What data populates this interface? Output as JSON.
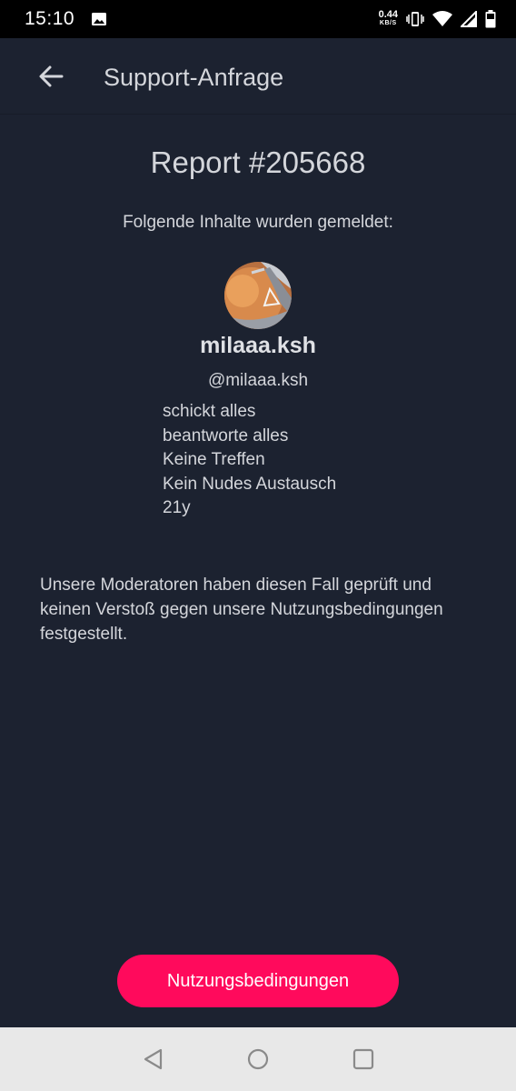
{
  "status_bar": {
    "time": "15:10",
    "net_speed_value": "0.44",
    "net_speed_unit": "KB/S",
    "icons": [
      "image-icon",
      "vibrate-icon",
      "wifi-icon",
      "signal-icon",
      "battery-icon"
    ]
  },
  "app_bar": {
    "title": "Support-Anfrage",
    "back_icon": "arrow-left-icon"
  },
  "report": {
    "title": "Report #205668",
    "subtitle": "Folgende Inhalte wurden gemeldet:"
  },
  "profile": {
    "name": "milaaa.ksh",
    "handle": "@milaaa.ksh",
    "bio": [
      "schickt alles",
      "beantworte alles",
      "Keine Treffen",
      "Kein Nudes Austausch",
      "21y"
    ]
  },
  "result": {
    "text": "Unsere Moderatoren haben diesen Fall geprüft und keinen Verstoß gegen unsere Nutzungsbedingungen festgestellt."
  },
  "actions": {
    "terms_button": "Nutzungsbedingungen"
  },
  "nav_bar": {
    "icons": [
      "back-triangle-icon",
      "home-circle-icon",
      "recents-square-icon"
    ]
  },
  "colors": {
    "background": "#1c2230",
    "accent": "#ff0a5c",
    "text": "#d4d6db",
    "nav_bar": "#e8e8e8"
  }
}
